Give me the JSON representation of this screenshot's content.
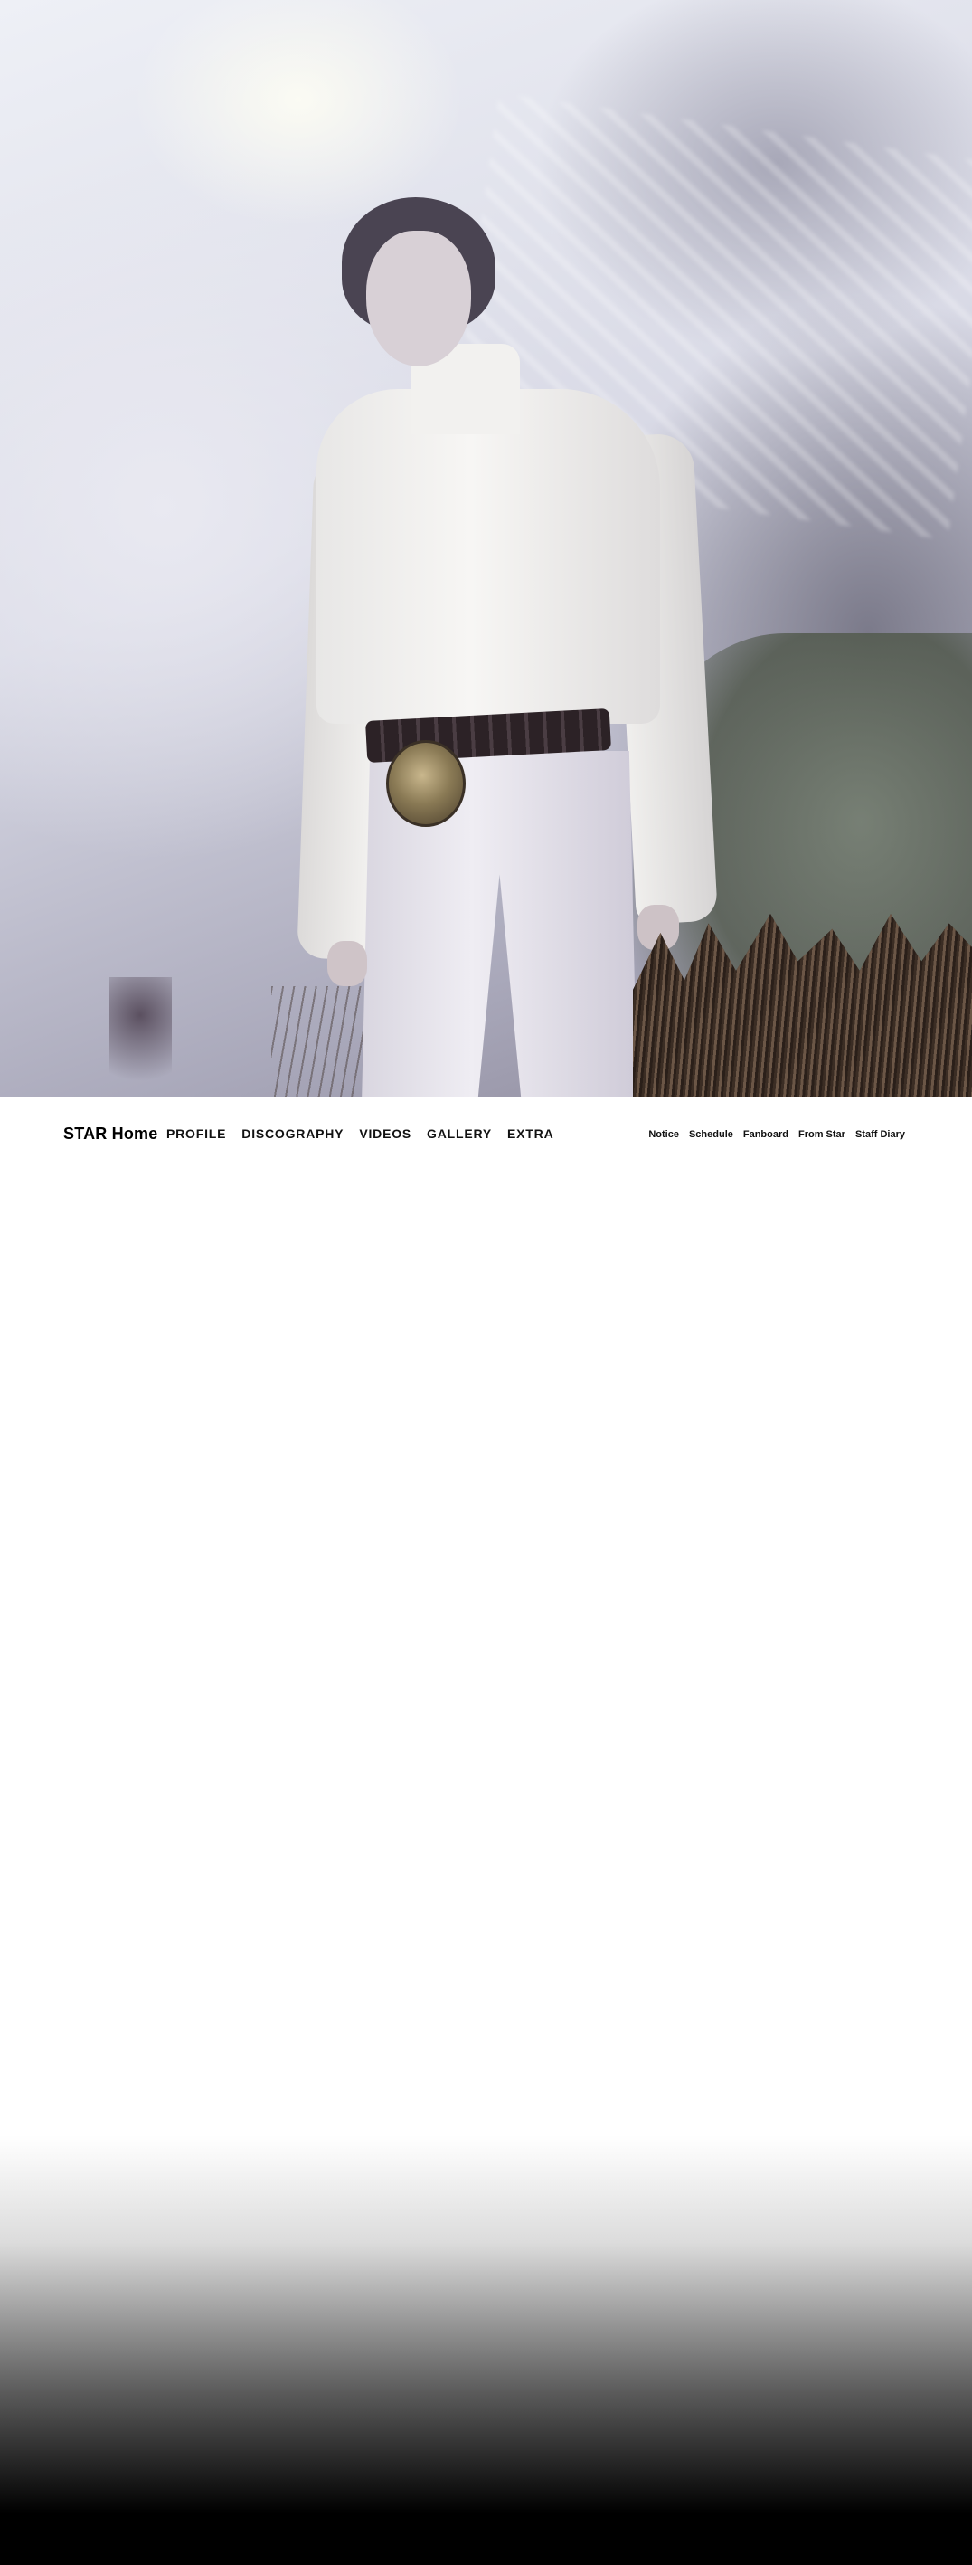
{
  "hero": {
    "image": "artist-photo-white-sweater-misty-forest"
  },
  "nav": {
    "brand": "STAR Home",
    "main_menu": [
      "PROFILE",
      "DISCOGRAPHY",
      "VIDEOS",
      "GALLERY",
      "EXTRA"
    ],
    "sub_menu": [
      "Notice",
      "Schedule",
      "Fanboard",
      "From Star",
      "Staff Diary"
    ]
  }
}
